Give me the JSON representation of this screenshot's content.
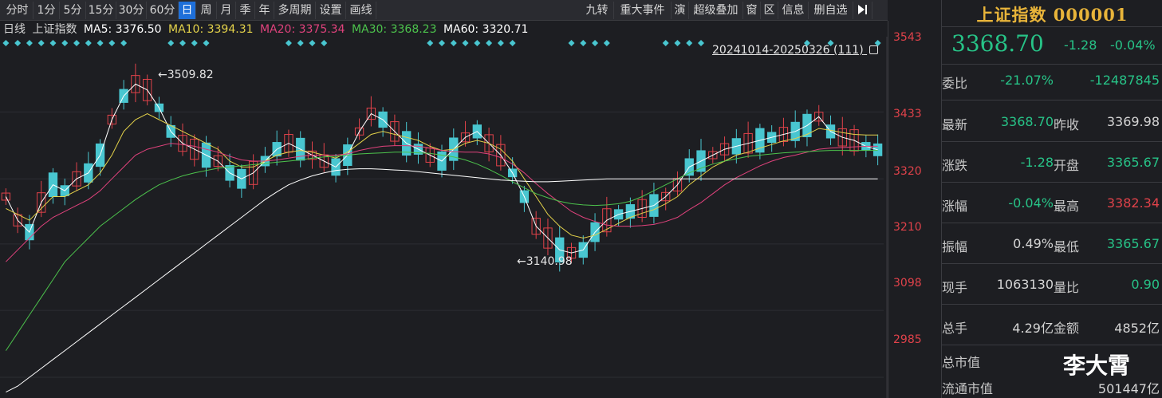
{
  "toolbar": {
    "periods": [
      "分时",
      "1分",
      "5分",
      "15分",
      "30分",
      "60分",
      "日",
      "周",
      "月",
      "季",
      "年",
      "多周期",
      "设置",
      "画线"
    ],
    "active_period": "日",
    "right_items": [
      "九转",
      "重大事件",
      "演",
      "超级叠加",
      "窗",
      "区",
      "信息",
      "删自选"
    ],
    "colors": {
      "active": "#1e6fd9"
    }
  },
  "legend": {
    "period": "日线",
    "name": "上证指数",
    "ma5": "MA5: 3376.50",
    "ma10": "MA10: 3394.31",
    "ma20": "MA20: 3375.34",
    "ma30": "MA30: 3368.23",
    "ma60": "MA60: 3320.71",
    "colors": {
      "ma5": "#ffffff",
      "ma10": "#e4d24a",
      "ma20": "#e0427c",
      "ma30": "#4cc24c",
      "ma60": "#ffffff"
    }
  },
  "chart": {
    "range_label": "20241014-20250326 (111)",
    "high_label": "3509.82",
    "low_label": "3140.98",
    "colors": {
      "up": "#e0424a",
      "down": "#49c6d0"
    }
  },
  "axis": {
    "ticks": [
      "3543",
      "3433",
      "3320",
      "3210",
      "3098",
      "2985"
    ]
  },
  "panel": {
    "title": "上证指数 000001",
    "price": "3368.70",
    "change": "-1.28",
    "pct": "-0.04%",
    "rows": [
      {
        "l1": "委比",
        "v1": "-21.07%",
        "l2": "",
        "v2": "-12487845",
        "c1": "green",
        "c2": "green"
      },
      {
        "l1": "最新",
        "v1": "3368.70",
        "l2": "昨收",
        "v2": "3369.98",
        "c1": "green",
        "c2": "white"
      },
      {
        "l1": "涨跌",
        "v1": "-1.28",
        "l2": "开盘",
        "v2": "3365.67",
        "c1": "green",
        "c2": "green"
      },
      {
        "l1": "涨幅",
        "v1": "-0.04%",
        "l2": "最高",
        "v2": "3382.34",
        "c1": "green",
        "c2": "red"
      },
      {
        "l1": "振幅",
        "v1": "0.49%",
        "l2": "最低",
        "v2": "3365.67",
        "c1": "white",
        "c2": "green"
      },
      {
        "l1": "现手",
        "v1": "1063130",
        "l2": "量比",
        "v2": "0.90",
        "c1": "white",
        "c2": "green"
      },
      {
        "l1": "总手",
        "v1": "4.29亿",
        "l2": "金额",
        "v2": "4852亿",
        "c1": "white",
        "c2": "white"
      },
      {
        "l1": "总市值",
        "v1": "",
        "l2": "",
        "v2": "",
        "c1": "white",
        "c2": "white"
      },
      {
        "l1": "流通市值",
        "v1": "",
        "l2": "",
        "v2": "501447亿",
        "c1": "white",
        "c2": "white"
      }
    ],
    "watermark": "李大霄"
  },
  "chart_data": {
    "type": "candlestick",
    "ylim": [
      2950,
      3560
    ],
    "ma": {
      "ma5": [
        3290,
        3250,
        3230,
        3280,
        3310,
        3300,
        3320,
        3330,
        3360,
        3420,
        3460,
        3480,
        3470,
        3440,
        3400,
        3380,
        3370,
        3360,
        3350,
        3330,
        3320,
        3330,
        3350,
        3370,
        3380,
        3370,
        3360,
        3350,
        3340,
        3360,
        3400,
        3430,
        3420,
        3400,
        3380,
        3370,
        3360,
        3350,
        3370,
        3390,
        3400,
        3380,
        3360,
        3330,
        3290,
        3240,
        3220,
        3200,
        3195,
        3200,
        3230,
        3250,
        3260,
        3265,
        3270,
        3275,
        3290,
        3310,
        3340,
        3350,
        3360,
        3370,
        3375,
        3380,
        3385,
        3390,
        3395,
        3400,
        3410,
        3425,
        3400,
        3390,
        3385,
        3375,
        3369
      ],
      "ma10": [
        3270,
        3260,
        3250,
        3270,
        3290,
        3290,
        3300,
        3310,
        3330,
        3360,
        3400,
        3420,
        3430,
        3420,
        3410,
        3400,
        3390,
        3380,
        3370,
        3350,
        3340,
        3340,
        3350,
        3360,
        3365,
        3368,
        3365,
        3360,
        3355,
        3365,
        3380,
        3395,
        3400,
        3395,
        3390,
        3385,
        3375,
        3368,
        3370,
        3380,
        3385,
        3380,
        3370,
        3350,
        3320,
        3290,
        3260,
        3240,
        3225,
        3220,
        3225,
        3235,
        3245,
        3255,
        3262,
        3268,
        3278,
        3290,
        3310,
        3325,
        3340,
        3350,
        3360,
        3365,
        3372,
        3378,
        3384,
        3388,
        3395,
        3405,
        3402,
        3398,
        3395,
        3394,
        3394
      ],
      "ma20": [
        3180,
        3200,
        3220,
        3240,
        3255,
        3265,
        3275,
        3285,
        3300,
        3320,
        3340,
        3360,
        3370,
        3375,
        3380,
        3378,
        3375,
        3370,
        3365,
        3358,
        3352,
        3350,
        3350,
        3352,
        3355,
        3358,
        3360,
        3360,
        3360,
        3362,
        3368,
        3372,
        3375,
        3376,
        3376,
        3375,
        3372,
        3368,
        3366,
        3365,
        3365,
        3362,
        3356,
        3345,
        3330,
        3312,
        3295,
        3280,
        3265,
        3255,
        3248,
        3242,
        3240,
        3240,
        3241,
        3243,
        3248,
        3255,
        3268,
        3280,
        3295,
        3310,
        3322,
        3332,
        3342,
        3350,
        3356,
        3360,
        3365,
        3370,
        3372,
        3373,
        3374,
        3375,
        3375
      ],
      "ma30": [
        3030,
        3060,
        3090,
        3120,
        3150,
        3180,
        3200,
        3220,
        3240,
        3255,
        3270,
        3285,
        3298,
        3310,
        3318,
        3325,
        3330,
        3334,
        3338,
        3340,
        3342,
        3344,
        3346,
        3348,
        3350,
        3352,
        3355,
        3357,
        3358,
        3360,
        3362,
        3363,
        3364,
        3365,
        3365,
        3364,
        3363,
        3360,
        3357,
        3352,
        3345,
        3336,
        3326,
        3315,
        3305,
        3295,
        3288,
        3282,
        3278,
        3276,
        3275,
        3276,
        3278,
        3282,
        3290,
        3300,
        3310,
        3320,
        3330,
        3338,
        3345,
        3350,
        3354,
        3358,
        3360,
        3362,
        3364,
        3365,
        3366,
        3367,
        3368,
        3368,
        3368,
        3368,
        3368
      ],
      "ma60": [
        2960,
        2970,
        2985,
        3000,
        3015,
        3030,
        3045,
        3060,
        3075,
        3090,
        3105,
        3120,
        3135,
        3150,
        3165,
        3180,
        3195,
        3210,
        3225,
        3240,
        3255,
        3270,
        3285,
        3298,
        3310,
        3318,
        3325,
        3330,
        3334,
        3336,
        3337,
        3337,
        3336,
        3335,
        3334,
        3332,
        3330,
        3328,
        3326,
        3324,
        3322,
        3320,
        3318,
        3317,
        3316,
        3315,
        3315,
        3316,
        3317,
        3318,
        3319,
        3320,
        3320,
        3320,
        3320,
        3320,
        3320,
        3320,
        3320,
        3320,
        3320,
        3320,
        3320,
        3320,
        3320,
        3320,
        3320,
        3320,
        3320,
        3320,
        3320,
        3320,
        3320,
        3320,
        3320
      ]
    },
    "marker_rows": [
      [
        0,
        1,
        2,
        3,
        4,
        5,
        6,
        7,
        8,
        9,
        10
      ],
      [
        14,
        15,
        16,
        17
      ],
      [
        24,
        25,
        26,
        27
      ],
      [
        36,
        37,
        38,
        39,
        40,
        41,
        42,
        43
      ],
      [
        48,
        49,
        50,
        51
      ],
      [
        56,
        57,
        58,
        59
      ],
      [
        68,
        70,
        74
      ]
    ]
  }
}
